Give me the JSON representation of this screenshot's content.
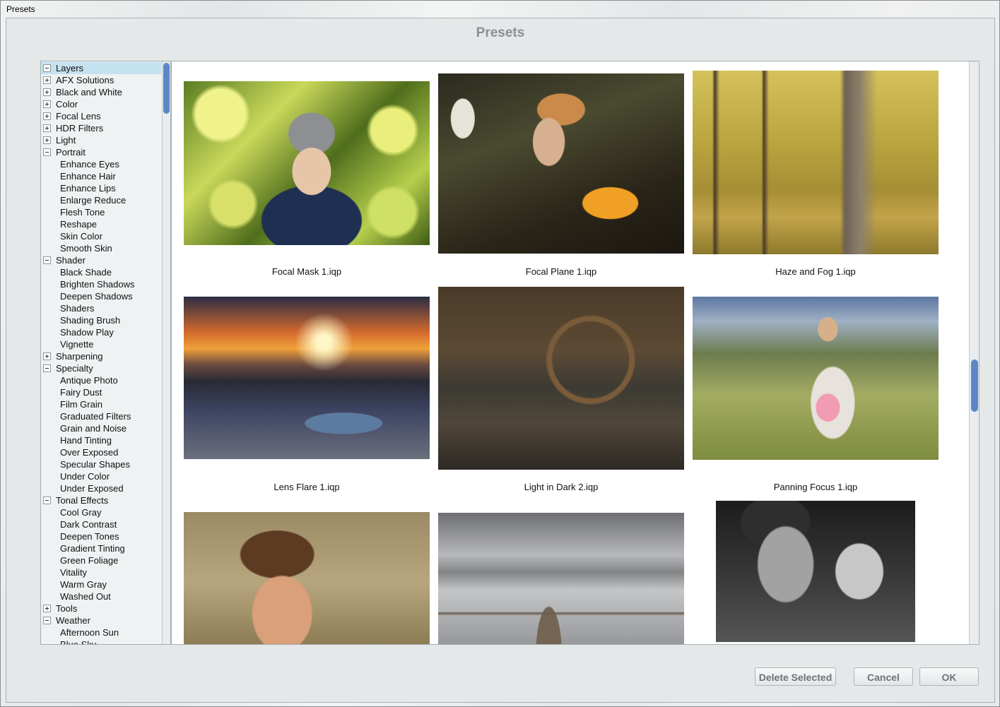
{
  "window": {
    "title": "Presets"
  },
  "dialog": {
    "title": "Presets"
  },
  "tree": [
    {
      "label": "Layers",
      "type": "group",
      "expanded": true,
      "selected": true
    },
    {
      "label": "AFX Solutions",
      "type": "group",
      "expanded": false
    },
    {
      "label": "Black and White",
      "type": "group",
      "expanded": false
    },
    {
      "label": "Color",
      "type": "group",
      "expanded": false
    },
    {
      "label": "Focal Lens",
      "type": "group",
      "expanded": false
    },
    {
      "label": "HDR Filters",
      "type": "group",
      "expanded": false
    },
    {
      "label": "Light",
      "type": "group",
      "expanded": false
    },
    {
      "label": "Portrait",
      "type": "group",
      "expanded": true
    },
    {
      "label": "Enhance Eyes",
      "type": "item"
    },
    {
      "label": "Enhance Hair",
      "type": "item"
    },
    {
      "label": "Enhance Lips",
      "type": "item"
    },
    {
      "label": "Enlarge Reduce",
      "type": "item"
    },
    {
      "label": "Flesh Tone",
      "type": "item"
    },
    {
      "label": "Reshape",
      "type": "item"
    },
    {
      "label": "Skin Color",
      "type": "item"
    },
    {
      "label": "Smooth Skin",
      "type": "item"
    },
    {
      "label": "Shader",
      "type": "group",
      "expanded": true
    },
    {
      "label": "Black Shade",
      "type": "item"
    },
    {
      "label": "Brighten Shadows",
      "type": "item"
    },
    {
      "label": "Deepen Shadows",
      "type": "item"
    },
    {
      "label": "Shaders",
      "type": "item"
    },
    {
      "label": "Shading Brush",
      "type": "item"
    },
    {
      "label": "Shadow Play",
      "type": "item"
    },
    {
      "label": "Vignette",
      "type": "item"
    },
    {
      "label": "Sharpening",
      "type": "group",
      "expanded": false
    },
    {
      "label": "Specialty",
      "type": "group",
      "expanded": true
    },
    {
      "label": "Antique Photo",
      "type": "item"
    },
    {
      "label": "Fairy Dust",
      "type": "item"
    },
    {
      "label": "Film Grain",
      "type": "item"
    },
    {
      "label": "Graduated Filters",
      "type": "item"
    },
    {
      "label": "Grain and Noise",
      "type": "item"
    },
    {
      "label": "Hand Tinting",
      "type": "item"
    },
    {
      "label": "Over Exposed",
      "type": "item"
    },
    {
      "label": "Specular Shapes",
      "type": "item"
    },
    {
      "label": "Under Color",
      "type": "item"
    },
    {
      "label": "Under Exposed",
      "type": "item"
    },
    {
      "label": "Tonal Effects",
      "type": "group",
      "expanded": true
    },
    {
      "label": "Cool Gray",
      "type": "item"
    },
    {
      "label": "Dark Contrast",
      "type": "item"
    },
    {
      "label": "Deepen Tones",
      "type": "item"
    },
    {
      "label": "Gradient Tinting",
      "type": "item"
    },
    {
      "label": "Green Foliage",
      "type": "item"
    },
    {
      "label": "Vitality",
      "type": "item"
    },
    {
      "label": "Warm Gray",
      "type": "item"
    },
    {
      "label": "Washed Out",
      "type": "item"
    },
    {
      "label": "Tools",
      "type": "group",
      "expanded": false
    },
    {
      "label": "Weather",
      "type": "group",
      "expanded": true
    },
    {
      "label": "Afternoon Sun",
      "type": "item"
    },
    {
      "label": "Blue Sky",
      "type": "item"
    }
  ],
  "presets": [
    {
      "caption": "Focal Mask 1.iqp",
      "style": "p1"
    },
    {
      "caption": "Focal Plane 1.iqp",
      "style": "p2"
    },
    {
      "caption": "Haze and Fog 1.iqp",
      "style": "p3"
    },
    {
      "caption": "Lens Flare 1.iqp",
      "style": "p4"
    },
    {
      "caption": "Light in Dark 2.iqp",
      "style": "p5"
    },
    {
      "caption": "Panning Focus 1.iqp",
      "style": "p6"
    },
    {
      "caption": "",
      "style": "p7"
    },
    {
      "caption": "",
      "style": "p8"
    },
    {
      "caption": "",
      "style": "p9"
    }
  ],
  "buttons": {
    "delete": "Delete Selected",
    "cancel": "Cancel",
    "ok": "OK"
  },
  "colors": {
    "scrollbar_thumb": "#5c86c7",
    "selection": "#c4e1ef"
  }
}
